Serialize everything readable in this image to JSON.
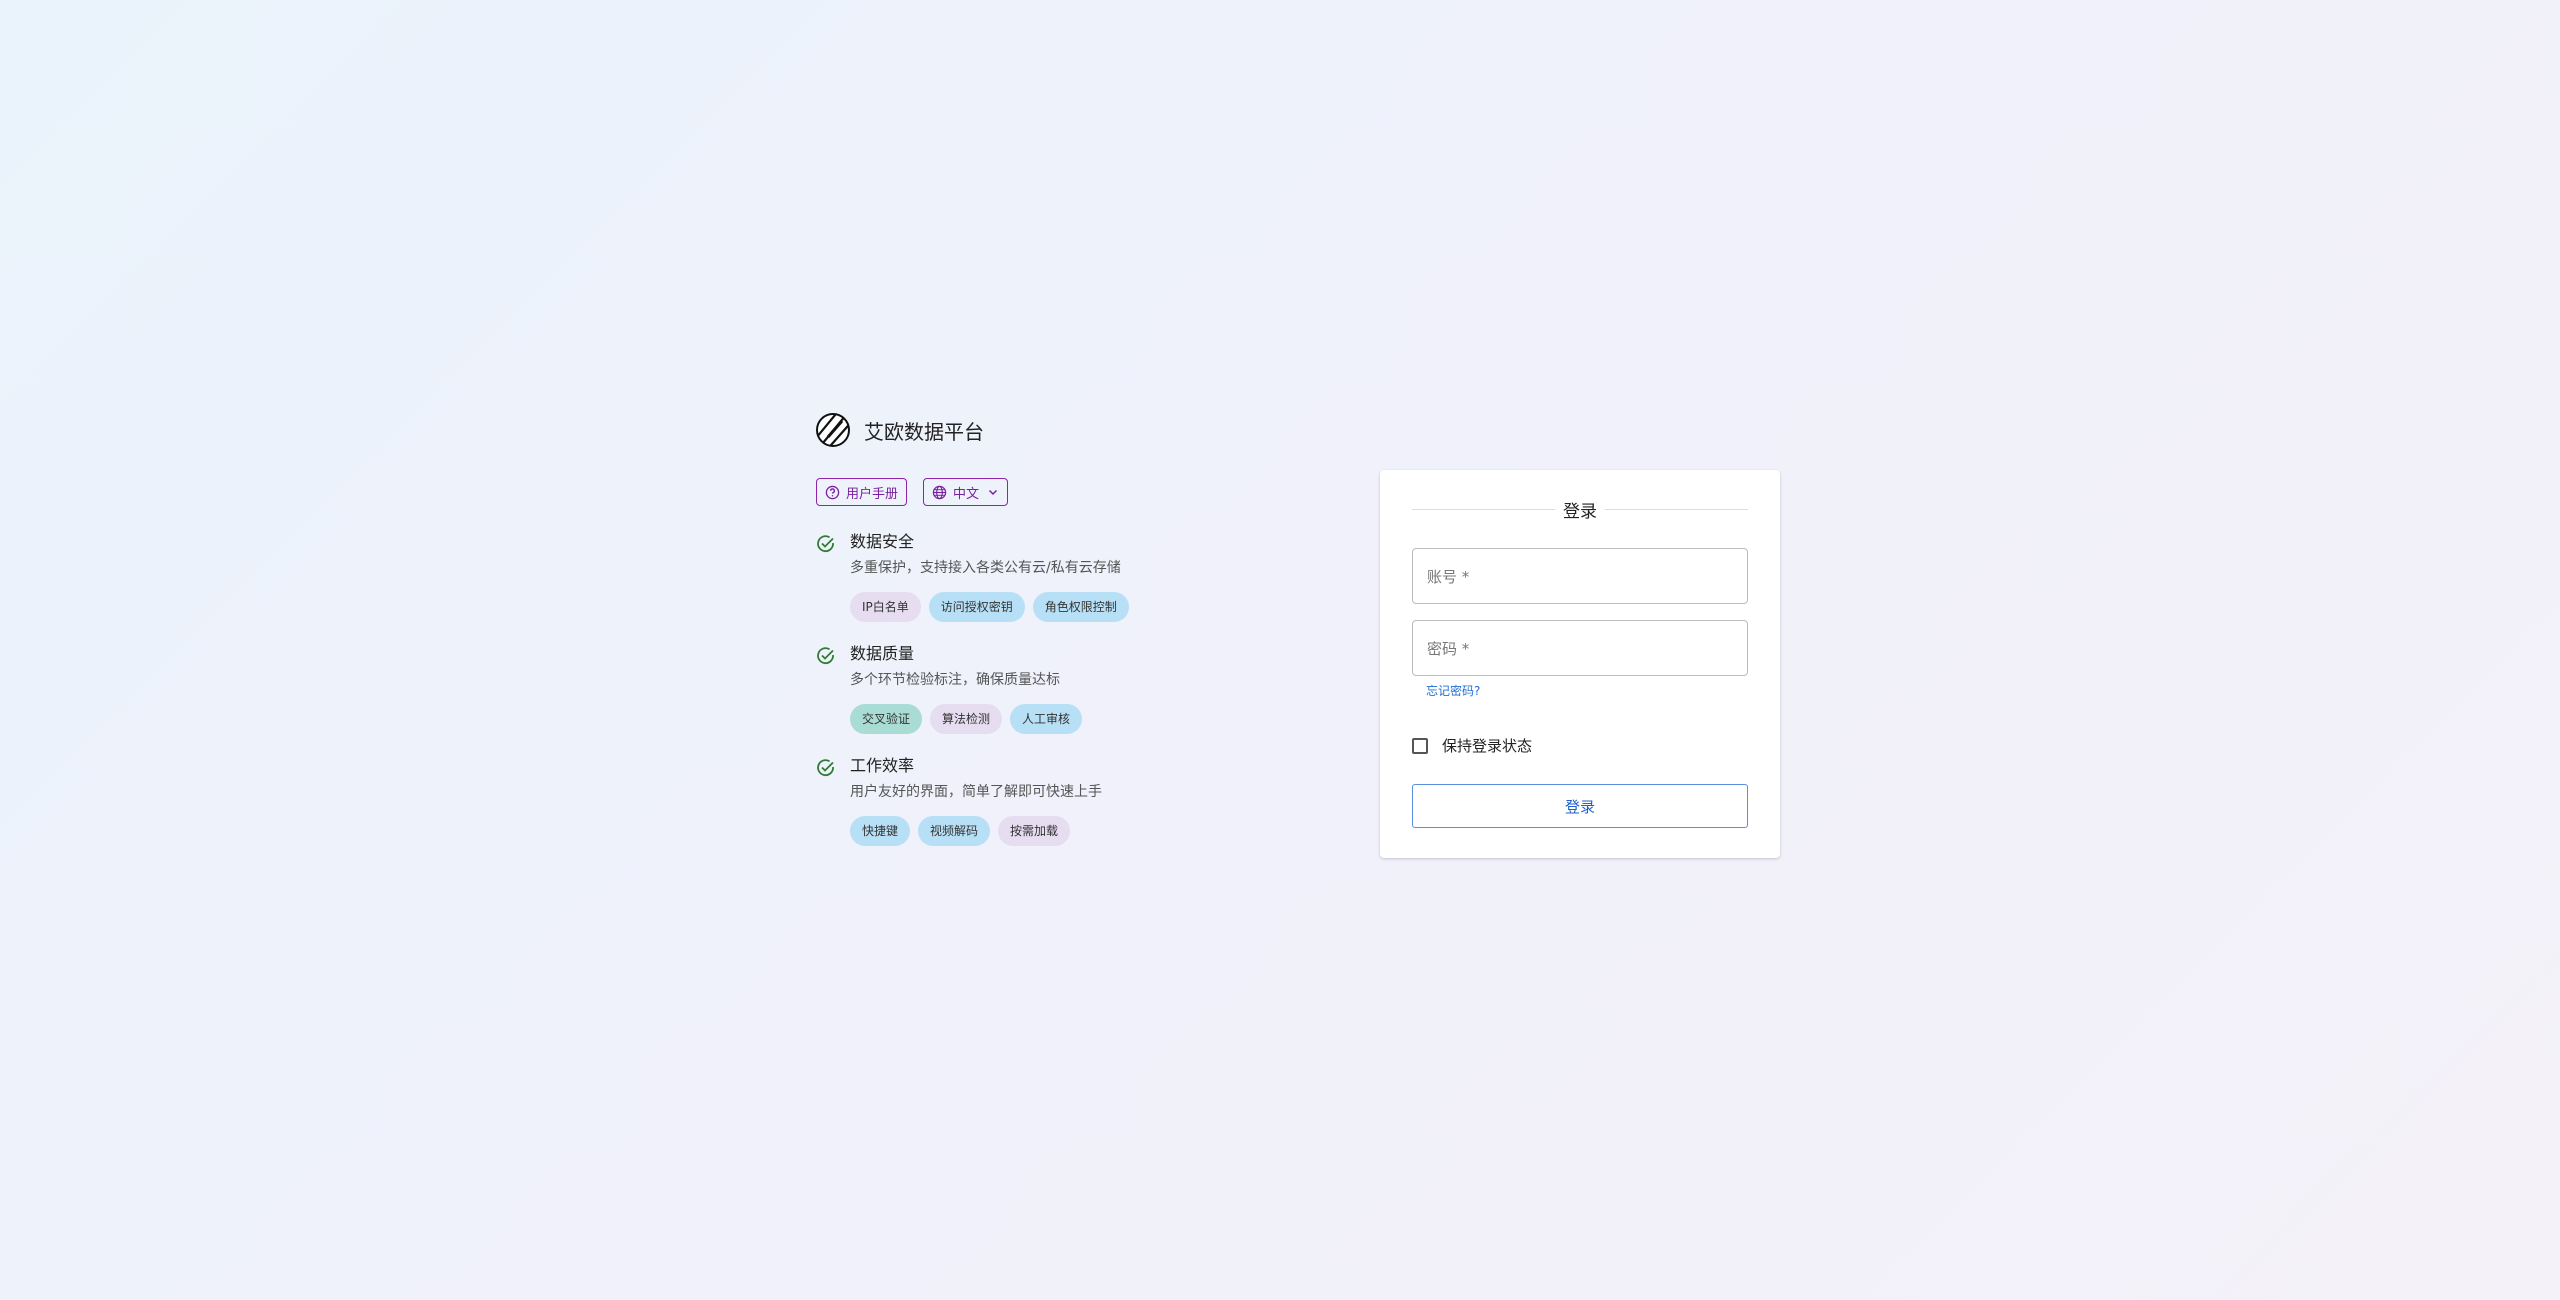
{
  "brand": {
    "name": "艾欧数据平台",
    "logo_icon": "striped-circle-logo"
  },
  "toolbar": {
    "manual_label": "用户手册",
    "manual_icon": "help-circle-icon",
    "language_label": "中文",
    "language_icon": "globe-icon"
  },
  "features": [
    {
      "title": "数据安全",
      "desc": "多重保护，支持接入各类公有云/私有云存储",
      "chips": [
        {
          "label": "IP白名单",
          "color": "purple"
        },
        {
          "label": "访问授权密钥",
          "color": "blue"
        },
        {
          "label": "角色权限控制",
          "color": "blue"
        }
      ]
    },
    {
      "title": "数据质量",
      "desc": "多个环节检验标注，确保质量达标",
      "chips": [
        {
          "label": "交叉验证",
          "color": "teal"
        },
        {
          "label": "算法检测",
          "color": "purple"
        },
        {
          "label": "人工审核",
          "color": "blue"
        }
      ]
    },
    {
      "title": "工作效率",
      "desc": "用户友好的界面，简单了解即可快速上手",
      "chips": [
        {
          "label": "快捷键",
          "color": "blue"
        },
        {
          "label": "视频解码",
          "color": "blue"
        },
        {
          "label": "按需加载",
          "color": "purple"
        }
      ]
    }
  ],
  "login": {
    "title": "登录",
    "account_placeholder": "账号 *",
    "password_placeholder": "密码 *",
    "forgot_label": "忘记密码?",
    "remember_label": "保持登录状态",
    "submit_label": "登录"
  },
  "colors": {
    "accent_purple": "#7b1fa2",
    "check_green": "#2e7d32",
    "link_blue": "#1e6fd9"
  }
}
